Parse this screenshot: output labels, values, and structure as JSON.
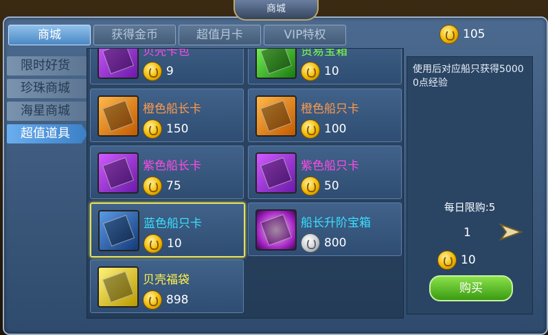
{
  "window": {
    "title": "商城"
  },
  "tabs": [
    {
      "label": "商城"
    },
    {
      "label": "获得金币"
    },
    {
      "label": "超值月卡"
    },
    {
      "label": "VIP特权"
    }
  ],
  "balance": "105",
  "sidebar": [
    {
      "label": "限时好货"
    },
    {
      "label": "珍珠商城"
    },
    {
      "label": "海星商城"
    },
    {
      "label": "超值道具"
    }
  ],
  "items": [
    {
      "name": "贝壳卡包",
      "price": "9",
      "currency": "gold"
    },
    {
      "name": "贸易宝箱",
      "price": "10",
      "currency": "gold"
    },
    {
      "name": "橙色船长卡",
      "price": "150",
      "currency": "gold"
    },
    {
      "name": "橙色船只卡",
      "price": "100",
      "currency": "gold"
    },
    {
      "name": "紫色船长卡",
      "price": "75",
      "currency": "gold"
    },
    {
      "name": "紫色船只卡",
      "price": "50",
      "currency": "gold"
    },
    {
      "name": "蓝色船只卡",
      "price": "10",
      "currency": "gold"
    },
    {
      "name": "船长升阶宝箱",
      "price": "800",
      "currency": "silver"
    },
    {
      "name": "贝壳福袋",
      "price": "898",
      "currency": "gold"
    }
  ],
  "detail": {
    "description": "使用后对应船只获得50000点经验",
    "daily_limit": "每日限购:5",
    "quantity": "1",
    "total": "10",
    "buy_label": "购买"
  }
}
